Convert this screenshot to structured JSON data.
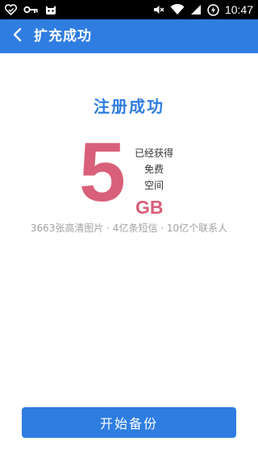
{
  "status_bar": {
    "time": "10:47",
    "left_icons": [
      "heart-check-icon",
      "key-icon",
      "cat-face-icon"
    ],
    "right_icons": [
      "mute-icon",
      "wifi-icon",
      "signal-icon",
      "battery-charging-icon"
    ]
  },
  "app_bar": {
    "title": "扩充成功"
  },
  "main": {
    "success_title": "注册成功",
    "amount": "5",
    "labels": [
      "已经获得",
      "免费",
      "空间"
    ],
    "unit": "GB",
    "caption": "3663张高清图片 · 4亿条短信 · 10亿个联系人"
  },
  "footer": {
    "start_label": "开始备份"
  },
  "colors": {
    "primary": "#2f7de1",
    "accent": "#d9607a",
    "caption": "#a0a0a0"
  }
}
